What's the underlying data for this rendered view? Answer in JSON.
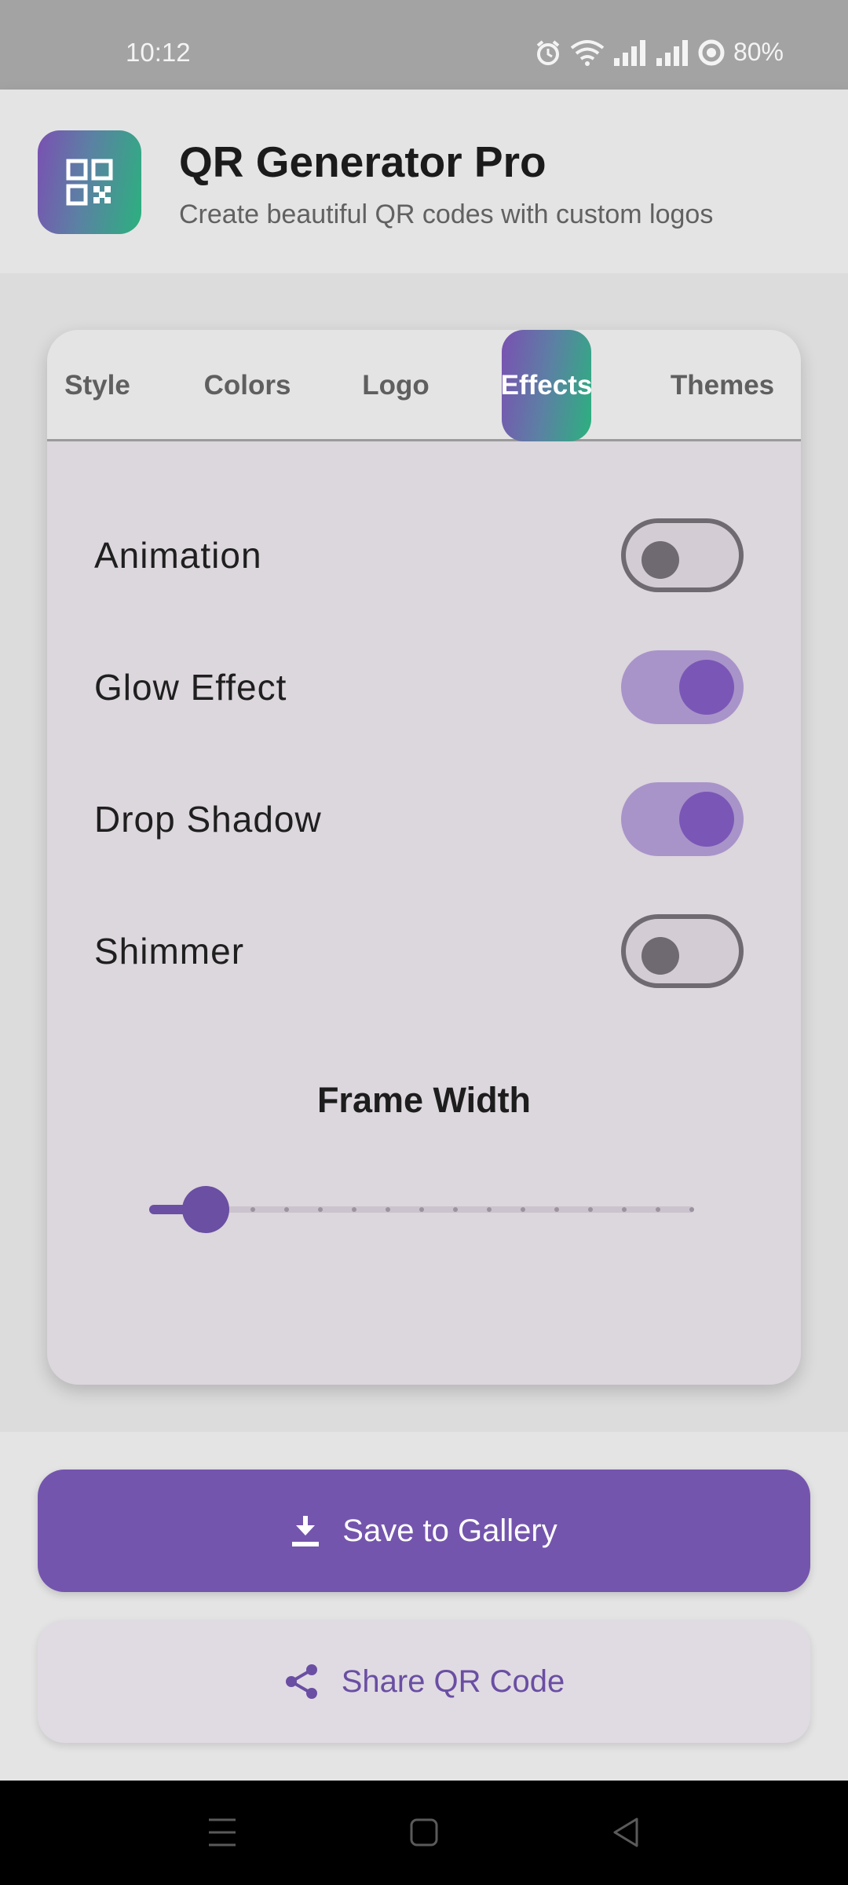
{
  "status_bar": {
    "time": "10:12",
    "battery": "80%"
  },
  "header": {
    "title": "QR Generator Pro",
    "subtitle": "Create beautiful QR codes with custom logos",
    "logo_icon": "qr-code-icon"
  },
  "tabs": [
    {
      "label": "Style",
      "active": false
    },
    {
      "label": "Colors",
      "active": false
    },
    {
      "label": "Logo",
      "active": false
    },
    {
      "label": "Effects",
      "active": true
    },
    {
      "label": "Themes",
      "active": false
    }
  ],
  "effects": {
    "toggles": [
      {
        "label": "Animation",
        "on": false
      },
      {
        "label": "Glow Effect",
        "on": true
      },
      {
        "label": "Drop Shadow",
        "on": true
      },
      {
        "label": "Shimmer",
        "on": false
      }
    ],
    "frame_width": {
      "label": "Frame Width",
      "value_fraction": 0.1,
      "steps": 17
    }
  },
  "actions": {
    "save": {
      "label": "Save to Gallery",
      "icon": "download-icon"
    },
    "share": {
      "label": "Share QR Code",
      "icon": "share-icon"
    }
  },
  "colors": {
    "accent": "#7455ad",
    "gradient_start": "#7a50b2",
    "gradient_end": "#2bb17e",
    "toggle_on_track": "#a894c9",
    "toggle_on_knob": "#7a57b6",
    "toggle_off": "#6f6a72"
  }
}
